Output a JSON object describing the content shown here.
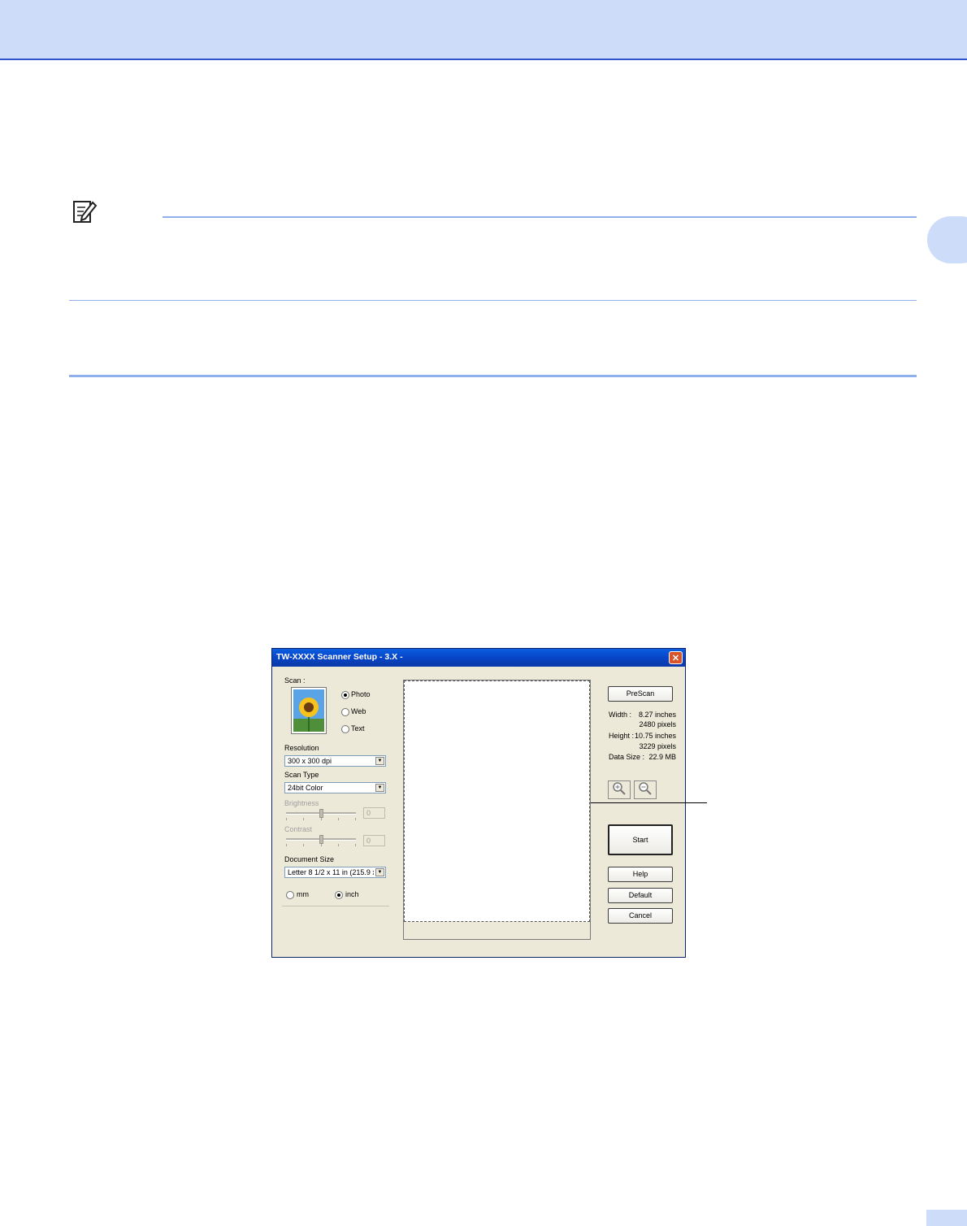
{
  "dialog": {
    "title": "TW-XXXX Scanner Setup - 3.X -",
    "close_glyph": "✕",
    "scan_label": "Scan :",
    "scan_options": [
      "Photo",
      "Web",
      "Text"
    ],
    "scan_selected": "Photo",
    "resolution_label": "Resolution",
    "resolution_value": "300 x 300 dpi",
    "scan_type_label": "Scan Type",
    "scan_type_value": "24bit Color",
    "brightness_label": "Brightness",
    "brightness_value": "0",
    "contrast_label": "Contrast",
    "contrast_value": "0",
    "document_size_label": "Document Size",
    "document_size_value": "Letter 8 1/2 x 11 in (215.9 x",
    "unit_options": [
      "mm",
      "inch"
    ],
    "unit_selected": "inch",
    "prescan_button": "PreScan",
    "width_label": "Width :",
    "width_inches": "8.27 inches",
    "width_pixels": "2480 pixels",
    "height_label": "Height :",
    "height_inches": "10.75 inches",
    "height_pixels": "3229 pixels",
    "data_size_label": "Data Size :",
    "data_size_value": "22.9 MB",
    "start_button": "Start",
    "help_button": "Help",
    "default_button": "Default",
    "cancel_button": "Cancel",
    "zoom_icons": [
      "zoom-in-icon",
      "zoom-out-icon"
    ]
  },
  "colors": {
    "header_band": "#cddcf8",
    "header_line": "#2c54c8",
    "rule": "#8fb0ea",
    "dialog_face": "#ece9d8",
    "titlebar": "#0845c7"
  }
}
